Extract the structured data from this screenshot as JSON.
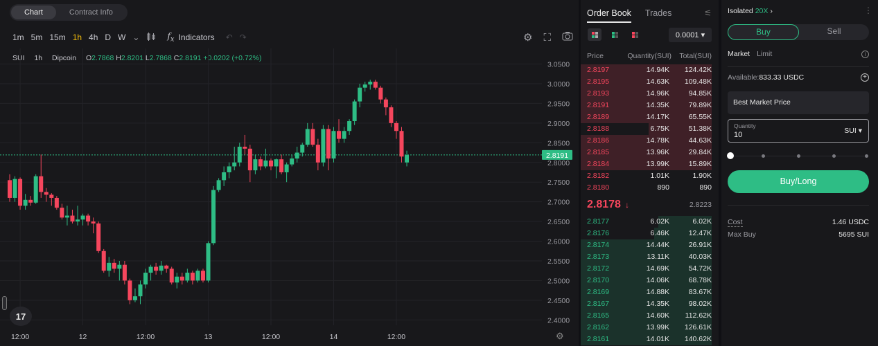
{
  "tabs": [
    "Chart",
    "Contract Info"
  ],
  "toolbar": {
    "timeframes": [
      "1m",
      "5m",
      "15m",
      "1h",
      "4h",
      "D",
      "W"
    ],
    "active_timeframe": "1h",
    "indicators_label": "Indicators"
  },
  "legend": {
    "symbol": "SUI",
    "interval": "1h",
    "exchange": "Dipcoin",
    "o_label": "O",
    "o_value": "2.7868",
    "h_label": "H",
    "h_value": "2.8201",
    "l_label": "L",
    "l_value": "2.7868",
    "c_label": "C",
    "c_value": "2.8191",
    "change": "+0.0202 (+0.72%)"
  },
  "tv_logo": "17",
  "chart_data": {
    "type": "candlestick",
    "y_ticks": [
      "3.0500",
      "3.0000",
      "2.9500",
      "2.9000",
      "2.8500",
      "2.8000",
      "2.7500",
      "2.7000",
      "2.6500",
      "2.6000",
      "2.5500",
      "2.5000",
      "2.4500",
      "2.4000"
    ],
    "ylim": [
      2.39,
      3.065
    ],
    "x_ticks": [
      {
        "label": "12:00",
        "index": 2
      },
      {
        "label": "12",
        "index": 14
      },
      {
        "label": "12:00",
        "index": 26
      },
      {
        "label": "13",
        "index": 38
      },
      {
        "label": "12:00",
        "index": 50
      },
      {
        "label": "14",
        "index": 62
      },
      {
        "label": "12:00",
        "index": 74
      }
    ],
    "last_price": "2.8191",
    "last_value": 2.8191,
    "up_color": "#2ebd85",
    "down_color": "#f6465d",
    "candles": [
      {
        "o": 2.755,
        "h": 2.77,
        "l": 2.7,
        "c": 2.71
      },
      {
        "o": 2.71,
        "h": 2.765,
        "l": 2.7,
        "c": 2.758
      },
      {
        "o": 2.758,
        "h": 2.762,
        "l": 2.68,
        "c": 2.69
      },
      {
        "o": 2.69,
        "h": 2.72,
        "l": 2.68,
        "c": 2.705
      },
      {
        "o": 2.705,
        "h": 2.715,
        "l": 2.69,
        "c": 2.698
      },
      {
        "o": 2.698,
        "h": 2.77,
        "l": 2.695,
        "c": 2.765
      },
      {
        "o": 2.765,
        "h": 2.82,
        "l": 2.71,
        "c": 2.725
      },
      {
        "o": 2.725,
        "h": 2.735,
        "l": 2.7,
        "c": 2.718
      },
      {
        "o": 2.718,
        "h": 2.722,
        "l": 2.69,
        "c": 2.71
      },
      {
        "o": 2.71,
        "h": 2.715,
        "l": 2.68,
        "c": 2.685
      },
      {
        "o": 2.685,
        "h": 2.695,
        "l": 2.655,
        "c": 2.66
      },
      {
        "o": 2.66,
        "h": 2.69,
        "l": 2.64,
        "c": 2.665
      },
      {
        "o": 2.665,
        "h": 2.68,
        "l": 2.645,
        "c": 2.65
      },
      {
        "o": 2.65,
        "h": 2.69,
        "l": 2.64,
        "c": 2.655
      },
      {
        "o": 2.655,
        "h": 2.67,
        "l": 2.64,
        "c": 2.665
      },
      {
        "o": 2.665,
        "h": 2.67,
        "l": 2.64,
        "c": 2.65
      },
      {
        "o": 2.65,
        "h": 2.66,
        "l": 2.62,
        "c": 2.645
      },
      {
        "o": 2.645,
        "h": 2.65,
        "l": 2.57,
        "c": 2.575
      },
      {
        "o": 2.575,
        "h": 2.58,
        "l": 2.52,
        "c": 2.525
      },
      {
        "o": 2.525,
        "h": 2.56,
        "l": 2.51,
        "c": 2.545
      },
      {
        "o": 2.545,
        "h": 2.555,
        "l": 2.52,
        "c": 2.53
      },
      {
        "o": 2.53,
        "h": 2.55,
        "l": 2.5,
        "c": 2.54
      },
      {
        "o": 2.54,
        "h": 2.55,
        "l": 2.49,
        "c": 2.5
      },
      {
        "o": 2.5,
        "h": 2.505,
        "l": 2.44,
        "c": 2.45
      },
      {
        "o": 2.45,
        "h": 2.48,
        "l": 2.445,
        "c": 2.46
      },
      {
        "o": 2.46,
        "h": 2.5,
        "l": 2.44,
        "c": 2.49
      },
      {
        "o": 2.49,
        "h": 2.53,
        "l": 2.48,
        "c": 2.52
      },
      {
        "o": 2.52,
        "h": 2.54,
        "l": 2.5,
        "c": 2.535
      },
      {
        "o": 2.535,
        "h": 2.545,
        "l": 2.515,
        "c": 2.525
      },
      {
        "o": 2.525,
        "h": 2.55,
        "l": 2.515,
        "c": 2.538
      },
      {
        "o": 2.538,
        "h": 2.54,
        "l": 2.52,
        "c": 2.53
      },
      {
        "o": 2.53,
        "h": 2.535,
        "l": 2.49,
        "c": 2.495
      },
      {
        "o": 2.495,
        "h": 2.52,
        "l": 2.48,
        "c": 2.51
      },
      {
        "o": 2.51,
        "h": 2.52,
        "l": 2.49,
        "c": 2.5
      },
      {
        "o": 2.5,
        "h": 2.53,
        "l": 2.495,
        "c": 2.52
      },
      {
        "o": 2.52,
        "h": 2.525,
        "l": 2.49,
        "c": 2.5
      },
      {
        "o": 2.5,
        "h": 2.53,
        "l": 2.495,
        "c": 2.525
      },
      {
        "o": 2.525,
        "h": 2.53,
        "l": 2.495,
        "c": 2.5
      },
      {
        "o": 2.5,
        "h": 2.6,
        "l": 2.495,
        "c": 2.595
      },
      {
        "o": 2.595,
        "h": 2.74,
        "l": 2.59,
        "c": 2.73
      },
      {
        "o": 2.73,
        "h": 2.76,
        "l": 2.725,
        "c": 2.755
      },
      {
        "o": 2.755,
        "h": 2.79,
        "l": 2.74,
        "c": 2.775
      },
      {
        "o": 2.775,
        "h": 2.8,
        "l": 2.76,
        "c": 2.79
      },
      {
        "o": 2.79,
        "h": 2.84,
        "l": 2.78,
        "c": 2.8
      },
      {
        "o": 2.8,
        "h": 2.85,
        "l": 2.79,
        "c": 2.84
      },
      {
        "o": 2.84,
        "h": 2.87,
        "l": 2.82,
        "c": 2.835
      },
      {
        "o": 2.835,
        "h": 2.845,
        "l": 2.75,
        "c": 2.78
      },
      {
        "o": 2.78,
        "h": 2.82,
        "l": 2.77,
        "c": 2.808
      },
      {
        "o": 2.808,
        "h": 2.815,
        "l": 2.78,
        "c": 2.79
      },
      {
        "o": 2.79,
        "h": 2.835,
        "l": 2.785,
        "c": 2.805
      },
      {
        "o": 2.805,
        "h": 2.81,
        "l": 2.78,
        "c": 2.79
      },
      {
        "o": 2.79,
        "h": 2.81,
        "l": 2.76,
        "c": 2.808
      },
      {
        "o": 2.808,
        "h": 2.82,
        "l": 2.77,
        "c": 2.775
      },
      {
        "o": 2.775,
        "h": 2.8,
        "l": 2.75,
        "c": 2.795
      },
      {
        "o": 2.795,
        "h": 2.82,
        "l": 2.79,
        "c": 2.81
      },
      {
        "o": 2.81,
        "h": 2.84,
        "l": 2.8,
        "c": 2.825
      },
      {
        "o": 2.825,
        "h": 2.85,
        "l": 2.815,
        "c": 2.845
      },
      {
        "o": 2.845,
        "h": 2.9,
        "l": 2.84,
        "c": 2.885
      },
      {
        "o": 2.885,
        "h": 2.9,
        "l": 2.84,
        "c": 2.845
      },
      {
        "o": 2.845,
        "h": 2.86,
        "l": 2.78,
        "c": 2.8
      },
      {
        "o": 2.8,
        "h": 2.895,
        "l": 2.79,
        "c": 2.885
      },
      {
        "o": 2.885,
        "h": 2.895,
        "l": 2.78,
        "c": 2.81
      },
      {
        "o": 2.81,
        "h": 2.89,
        "l": 2.8,
        "c": 2.88
      },
      {
        "o": 2.88,
        "h": 2.91,
        "l": 2.85,
        "c": 2.86
      },
      {
        "o": 2.86,
        "h": 2.89,
        "l": 2.85,
        "c": 2.88
      },
      {
        "o": 2.88,
        "h": 2.91,
        "l": 2.87,
        "c": 2.905
      },
      {
        "o": 2.905,
        "h": 2.96,
        "l": 2.895,
        "c": 2.955
      },
      {
        "o": 2.955,
        "h": 3.0,
        "l": 2.94,
        "c": 2.99
      },
      {
        "o": 2.99,
        "h": 3.005,
        "l": 2.98,
        "c": 2.998
      },
      {
        "o": 2.998,
        "h": 3.01,
        "l": 2.985,
        "c": 3.005
      },
      {
        "o": 3.005,
        "h": 3.01,
        "l": 2.985,
        "c": 2.99
      },
      {
        "o": 2.99,
        "h": 2.995,
        "l": 2.95,
        "c": 2.96
      },
      {
        "o": 2.96,
        "h": 2.965,
        "l": 2.92,
        "c": 2.94
      },
      {
        "o": 2.94,
        "h": 2.945,
        "l": 2.89,
        "c": 2.9
      },
      {
        "o": 2.9,
        "h": 2.905,
        "l": 2.86,
        "c": 2.88
      },
      {
        "o": 2.88,
        "h": 2.89,
        "l": 2.8,
        "c": 2.815
      },
      {
        "o": 2.8,
        "h": 2.83,
        "l": 2.79,
        "c": 2.819
      }
    ]
  },
  "order_book": {
    "tabs": [
      "Order Book",
      "Trades"
    ],
    "precision": "0.0001 ▾",
    "headers": [
      "Price",
      "Quantity(SUI)",
      "Total(SUI)"
    ],
    "asks": [
      {
        "price": "2.8197",
        "qty": "14.94K",
        "total": "124.42K",
        "depth": 1.0
      },
      {
        "price": "2.8195",
        "qty": "14.63K",
        "total": "109.48K",
        "depth": 1.0
      },
      {
        "price": "2.8193",
        "qty": "14.96K",
        "total": "94.85K",
        "depth": 1.0
      },
      {
        "price": "2.8191",
        "qty": "14.35K",
        "total": "79.89K",
        "depth": 1.0
      },
      {
        "price": "2.8189",
        "qty": "14.17K",
        "total": "65.55K",
        "depth": 1.0
      },
      {
        "price": "2.8188",
        "qty": "6.75K",
        "total": "51.38K",
        "depth": 0.48
      },
      {
        "price": "2.8186",
        "qty": "14.78K",
        "total": "44.63K",
        "depth": 1.0
      },
      {
        "price": "2.8185",
        "qty": "13.96K",
        "total": "29.84K",
        "depth": 1.0
      },
      {
        "price": "2.8184",
        "qty": "13.99K",
        "total": "15.89K",
        "depth": 1.0
      },
      {
        "price": "2.8182",
        "qty": "1.01K",
        "total": "1.90K",
        "depth": 0
      },
      {
        "price": "2.8180",
        "qty": "890",
        "total": "890",
        "depth": 0
      }
    ],
    "mid_price": "2.8178",
    "mark_price": "2.8223",
    "bids": [
      {
        "price": "2.8177",
        "qty": "6.02K",
        "total": "6.02K",
        "depth": 0.41
      },
      {
        "price": "2.8176",
        "qty": "6.46K",
        "total": "12.47K",
        "depth": 0.44
      },
      {
        "price": "2.8174",
        "qty": "14.44K",
        "total": "26.91K",
        "depth": 1.0
      },
      {
        "price": "2.8173",
        "qty": "13.11K",
        "total": "40.03K",
        "depth": 1.0
      },
      {
        "price": "2.8172",
        "qty": "14.69K",
        "total": "54.72K",
        "depth": 1.0
      },
      {
        "price": "2.8170",
        "qty": "14.06K",
        "total": "68.78K",
        "depth": 1.0
      },
      {
        "price": "2.8169",
        "qty": "14.88K",
        "total": "83.67K",
        "depth": 1.0
      },
      {
        "price": "2.8167",
        "qty": "14.35K",
        "total": "98.02K",
        "depth": 1.0
      },
      {
        "price": "2.8165",
        "qty": "14.60K",
        "total": "112.62K",
        "depth": 1.0
      },
      {
        "price": "2.8162",
        "qty": "13.99K",
        "total": "126.61K",
        "depth": 1.0
      },
      {
        "price": "2.8161",
        "qty": "14.01K",
        "total": "140.62K",
        "depth": 1.0
      }
    ]
  },
  "trade_panel": {
    "margin_mode": "Isolated",
    "leverage": "20X",
    "buy_label": "Buy",
    "sell_label": "Sell",
    "order_types": [
      "Market",
      "Limit"
    ],
    "available_label": "Available:",
    "available_value": "833.33 USDC",
    "price_field": "Best Market Price",
    "quantity_label": "Quantity",
    "quantity_value": "10",
    "quantity_unit": "SUI ▾",
    "slider_fraction": 0,
    "submit_label": "Buy/Long",
    "cost_label": "Cost",
    "cost_value": "1.46 USDC",
    "maxbuy_label": "Max Buy",
    "maxbuy_value": "5695 SUI"
  }
}
